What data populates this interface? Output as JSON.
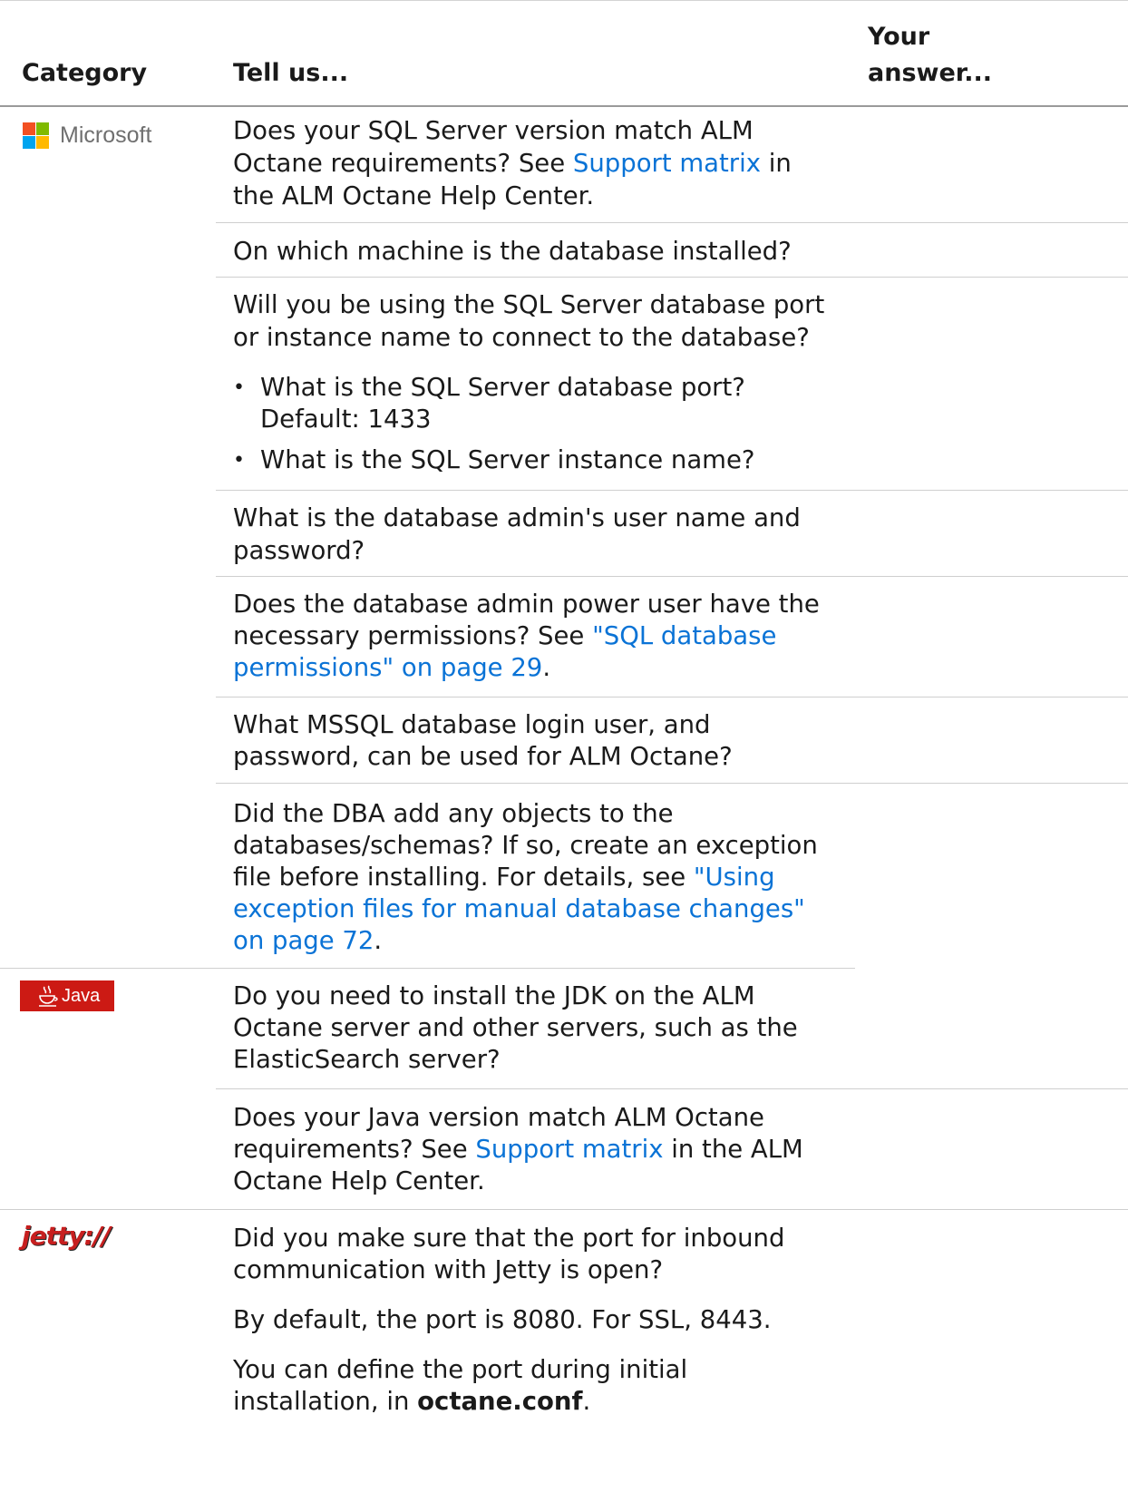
{
  "header": {
    "category": "Category",
    "tell_us": "Tell us...",
    "answer_line1": "Your",
    "answer_line2": "answer..."
  },
  "logos": {
    "microsoft": {
      "label": "Microsoft",
      "colors": [
        "#f25022",
        "#7fba00",
        "#00a4ef",
        "#ffb900"
      ]
    },
    "java": {
      "label": "Java",
      "bg": "#cc1a14"
    },
    "jetty": {
      "label": "jetty://"
    }
  },
  "rows": {
    "r1": {
      "l1": "Does your SQL Server version match ALM",
      "l2a": "Octane requirements? See ",
      "l2link": "Support matrix",
      "l2b": " in",
      "l3": "the ALM Octane Help Center."
    },
    "r2": {
      "l1": "On which machine is the database installed?"
    },
    "r3": {
      "l1": "Will you be using the SQL Server database port",
      "l2": "or instance name to connect to the database?",
      "b1a": "What is the SQL Server database port?",
      "b1b": "Default: 1433",
      "b2": "What is the SQL Server instance name?"
    },
    "r4": {
      "l1": "What is the database admin's user name and",
      "l2": "password?"
    },
    "r5": {
      "l1": "Does the database admin power user have the",
      "l2a": "necessary permissions? See ",
      "l2link": "\"SQL database",
      "l3link": "permissions\" on page 29",
      "l3b": "."
    },
    "r6": {
      "l1": "What MSSQL database login user, and",
      "l2": "password, can be used for ALM Octane?"
    },
    "r7": {
      "l1": "Did the DBA add any objects to the",
      "l2": "databases/schemas? If so, create an exception",
      "l3a": "file before installing. For details, see ",
      "l3link": "\"Using",
      "l4link": "exception files for manual database changes\"",
      "l5link": "on page 72",
      "l5b": "."
    },
    "r8": {
      "l1": "Do you need to install the JDK on the ALM",
      "l2": "Octane server and other servers, such as the",
      "l3": "ElasticSearch server?"
    },
    "r9": {
      "l1": "Does your Java version match ALM Octane",
      "l2a": "requirements? See ",
      "l2link": "Support matrix",
      "l2b": " in the ALM",
      "l3": "Octane Help Center."
    },
    "r10": {
      "l1": "Did you make sure that the port for inbound",
      "l2": "communication with Jetty is open?",
      "p2": "By default, the port is 8080. For SSL, 8443.",
      "p3l1": "You can define the port during initial",
      "p3l2a": "installation, in ",
      "p3l2bold": "octane.conf",
      "p3l2b": "."
    }
  }
}
